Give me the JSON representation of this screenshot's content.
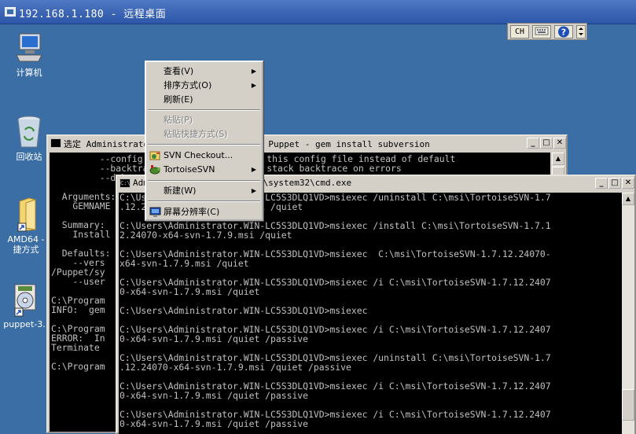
{
  "remote_bar": {
    "title": "192.168.1.180 - 远程桌面"
  },
  "language_bar": {
    "lang": "CH",
    "keyboard_icon": "keyboard-icon",
    "help_icon": "help-icon",
    "options": "▸"
  },
  "desktop": {
    "icons": [
      {
        "label": "计算机",
        "icon": "computer-icon"
      },
      {
        "label": "回收站",
        "icon": "recycle-bin-icon"
      },
      {
        "label": "AMD64 -",
        "label2": "捷方式",
        "icon": "folder-shortcut-icon"
      },
      {
        "label": "puppet-3.",
        "icon": "installer-icon"
      }
    ]
  },
  "back_window": {
    "title": "选定 Administrator: Command Prompt with Puppet - gem  install subversion",
    "lines": [
      "         --config FILE              Use this config file instead of default",
      "         --backtrace               Show stack backtrace on errors",
      "         --debug",
      "",
      "  Arguments:",
      "    GEMNAME",
      "",
      "  Summary:",
      "    Install",
      "",
      "  Defaults:",
      "    --vers",
      "/Puppet/sy",
      "    --user",
      "",
      "C:\\Program",
      "INFO:  gem",
      "",
      "C:\\Program",
      "ERROR:  In",
      "Terminate",
      "",
      "C:\\Program"
    ]
  },
  "front_window": {
    "title": "Administrator: C:\\Windows\\system32\\cmd.exe",
    "lines": [
      "C:\\Users\\Administrator.WIN-LC5S3DLQ1VD>msiexec /uninstall C:\\msi\\TortoiseSVN-1.7",
      ".12.24070-x64-svn-1.7.9.msi /quiet",
      "",
      "C:\\Users\\Administrator.WIN-LC5S3DLQ1VD>msiexec /install C:\\msi\\TortoiseSVN-1.7.1",
      "2.24070-x64-svn-1.7.9.msi /quiet",
      "",
      "C:\\Users\\Administrator.WIN-LC5S3DLQ1VD>msiexec  C:\\msi\\TortoiseSVN-1.7.12.24070-",
      "x64-svn-1.7.9.msi /quiet",
      "",
      "C:\\Users\\Administrator.WIN-LC5S3DLQ1VD>msiexec /i C:\\msi\\TortoiseSVN-1.7.12.2407",
      "0-x64-svn-1.7.9.msi /quiet",
      "",
      "C:\\Users\\Administrator.WIN-LC5S3DLQ1VD>msiexec",
      "",
      "C:\\Users\\Administrator.WIN-LC5S3DLQ1VD>msiexec /i C:\\msi\\TortoiseSVN-1.7.12.2407",
      "0-x64-svn-1.7.9.msi /quiet /passive",
      "",
      "C:\\Users\\Administrator.WIN-LC5S3DLQ1VD>msiexec /uninstall C:\\msi\\TortoiseSVN-1.7",
      ".12.24070-x64-svn-1.7.9.msi /quiet /passive",
      "",
      "C:\\Users\\Administrator.WIN-LC5S3DLQ1VD>msiexec /i C:\\msi\\TortoiseSVN-1.7.12.2407",
      "0-x64-svn-1.7.9.msi /quiet /passive",
      "",
      "C:\\Users\\Administrator.WIN-LC5S3DLQ1VD>msiexec /i C:\\msi\\TortoiseSVN-1.7.12.2407",
      "0-x64-svn-1.7.9.msi /quiet /passive"
    ]
  },
  "context_menu": {
    "items": [
      {
        "label": "查看(V)",
        "submenu": true
      },
      {
        "label": "排序方式(O)",
        "submenu": true
      },
      {
        "label": "刷新(E)"
      },
      {
        "label": "粘贴(P)",
        "disabled": true
      },
      {
        "label": "粘贴快捷方式(S)",
        "disabled": true
      },
      {
        "label": "SVN Checkout...",
        "icon": "svn-checkout-icon"
      },
      {
        "label": "TortoiseSVN",
        "submenu": true,
        "icon": "tortoisesvn-icon"
      },
      {
        "label": "新建(W)",
        "submenu": true
      },
      {
        "label": "屏幕分辨率(C)",
        "icon": "screen-resolution-icon"
      }
    ]
  },
  "colors": {
    "desktop": "#3a6ea5",
    "console_bg": "#000000",
    "console_fg": "#c0c0c0",
    "menu_bg": "#d4d0c8"
  }
}
